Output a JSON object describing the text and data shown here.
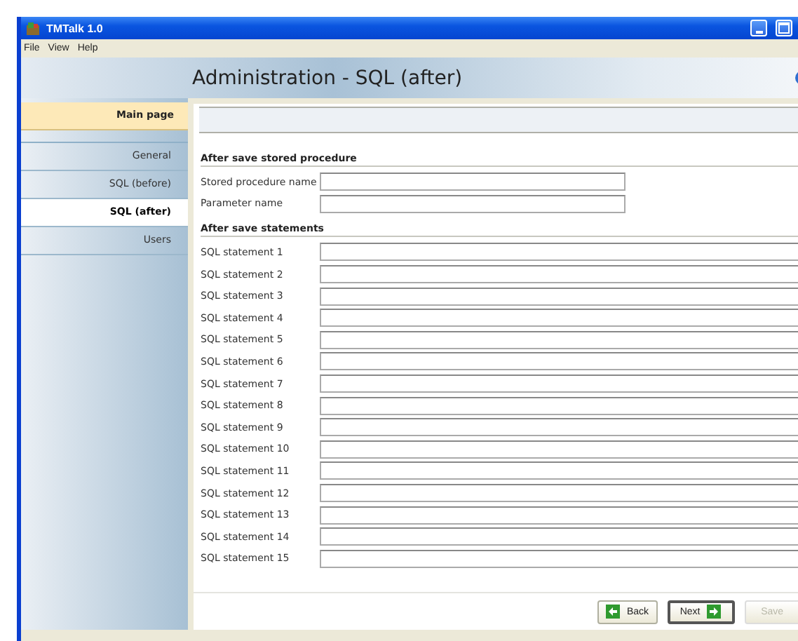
{
  "window": {
    "title": "TMTalk 1.0"
  },
  "menu": [
    "File",
    "View",
    "Help"
  ],
  "page_title": "Administration - SQL (after)",
  "sidebar": {
    "header": "Main page",
    "items": [
      {
        "label": "General",
        "selected": false
      },
      {
        "label": "SQL (before)",
        "selected": false
      },
      {
        "label": "SQL (after)",
        "selected": true
      },
      {
        "label": "Users",
        "selected": false
      }
    ]
  },
  "sections": [
    {
      "title": "After save stored procedure",
      "fields": [
        {
          "label": "Stored procedure name",
          "kind": "short"
        },
        {
          "label": "Parameter name",
          "kind": "short"
        }
      ]
    },
    {
      "title": "After save statements",
      "fields": [
        {
          "label": "SQL statement 1",
          "kind": "long"
        },
        {
          "label": "SQL statement 2",
          "kind": "long"
        },
        {
          "label": "SQL statement 3",
          "kind": "long"
        },
        {
          "label": "SQL statement 4",
          "kind": "long"
        },
        {
          "label": "SQL statement 5",
          "kind": "long"
        },
        {
          "label": "SQL statement 6",
          "kind": "long"
        },
        {
          "label": "SQL statement 7",
          "kind": "long"
        },
        {
          "label": "SQL statement 8",
          "kind": "long"
        },
        {
          "label": "SQL statement 9",
          "kind": "long"
        },
        {
          "label": "SQL statement 10",
          "kind": "long"
        },
        {
          "label": "SQL statement 11",
          "kind": "long"
        },
        {
          "label": "SQL statement 12",
          "kind": "long"
        },
        {
          "label": "SQL statement 13",
          "kind": "long"
        },
        {
          "label": "SQL statement 14",
          "kind": "long"
        },
        {
          "label": "SQL statement 15",
          "kind": "long"
        }
      ]
    }
  ],
  "buttons": [
    {
      "label": "Back",
      "kind": "back",
      "disabled": false
    },
    {
      "label": "Next",
      "kind": "next",
      "disabled": false
    },
    {
      "label": "Save",
      "kind": "save",
      "disabled": true
    }
  ]
}
